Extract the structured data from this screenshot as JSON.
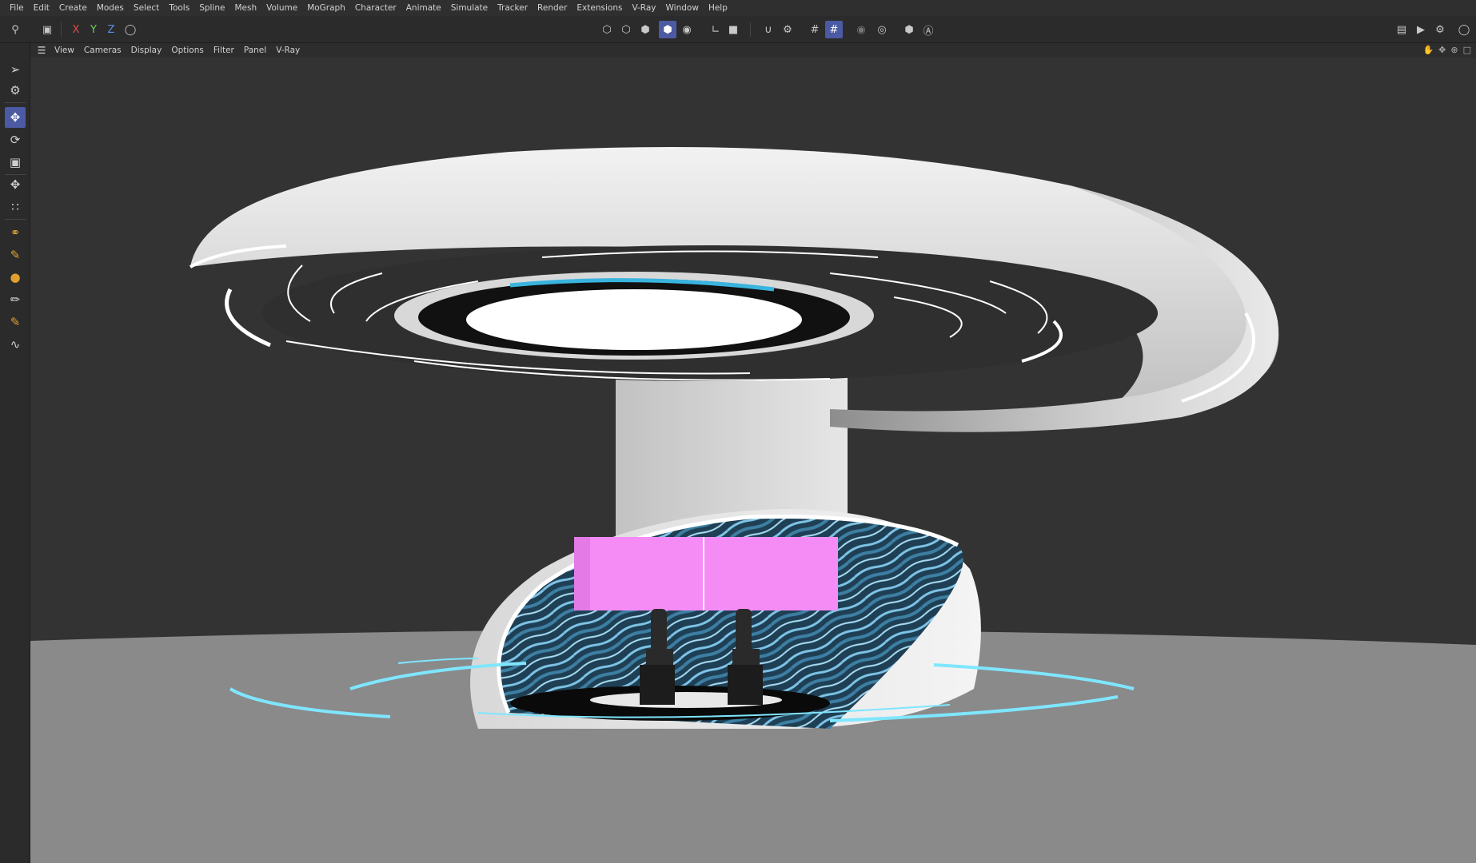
{
  "menu": [
    "File",
    "Edit",
    "Create",
    "Modes",
    "Select",
    "Tools",
    "Spline",
    "Mesh",
    "Volume",
    "MoGraph",
    "Character",
    "Animate",
    "Simulate",
    "Tracker",
    "Render",
    "Extensions",
    "V-Ray",
    "Window",
    "Help"
  ],
  "toolbar": {
    "axis_x": "X",
    "axis_y": "Y",
    "axis_z": "Z",
    "icons": [
      "undo-icon",
      "axis-x-toggle",
      "axis-y-toggle",
      "axis-z-toggle",
      "coordinate-system-icon",
      "points-mode-icon",
      "edges-mode-icon",
      "polygons-mode-icon",
      "model-mode-icon",
      "texture-mode-icon",
      "workplane-icon",
      "snap-icon",
      "snap-settings-icon",
      "grid-snap-icon",
      "quantize-icon",
      "solo-icon",
      "isolate-icon",
      "render-view-icon",
      "render-picture-viewer-icon",
      "render-settings-icon"
    ]
  },
  "left_tools": [
    "search-icon",
    "live-selection-icon",
    "selection-settings-icon",
    "move-icon",
    "rotate-icon",
    "scale-icon",
    "transform-icon",
    "points-transform-icon",
    "soft-selection-icon",
    "sculpt-icon",
    "paint-icon",
    "brush-icon",
    "knife-icon",
    "spline-pen-icon"
  ],
  "viewport_menu": [
    "View",
    "Cameras",
    "Display",
    "Options",
    "Filter",
    "Panel",
    "V-Ray"
  ],
  "colors": {
    "accent": "#4c5aa3",
    "background": "#333333",
    "floor": "#8c8c8c",
    "screen_magenta": "#f58cf5",
    "ring_cyan": "#7fe6ff"
  }
}
